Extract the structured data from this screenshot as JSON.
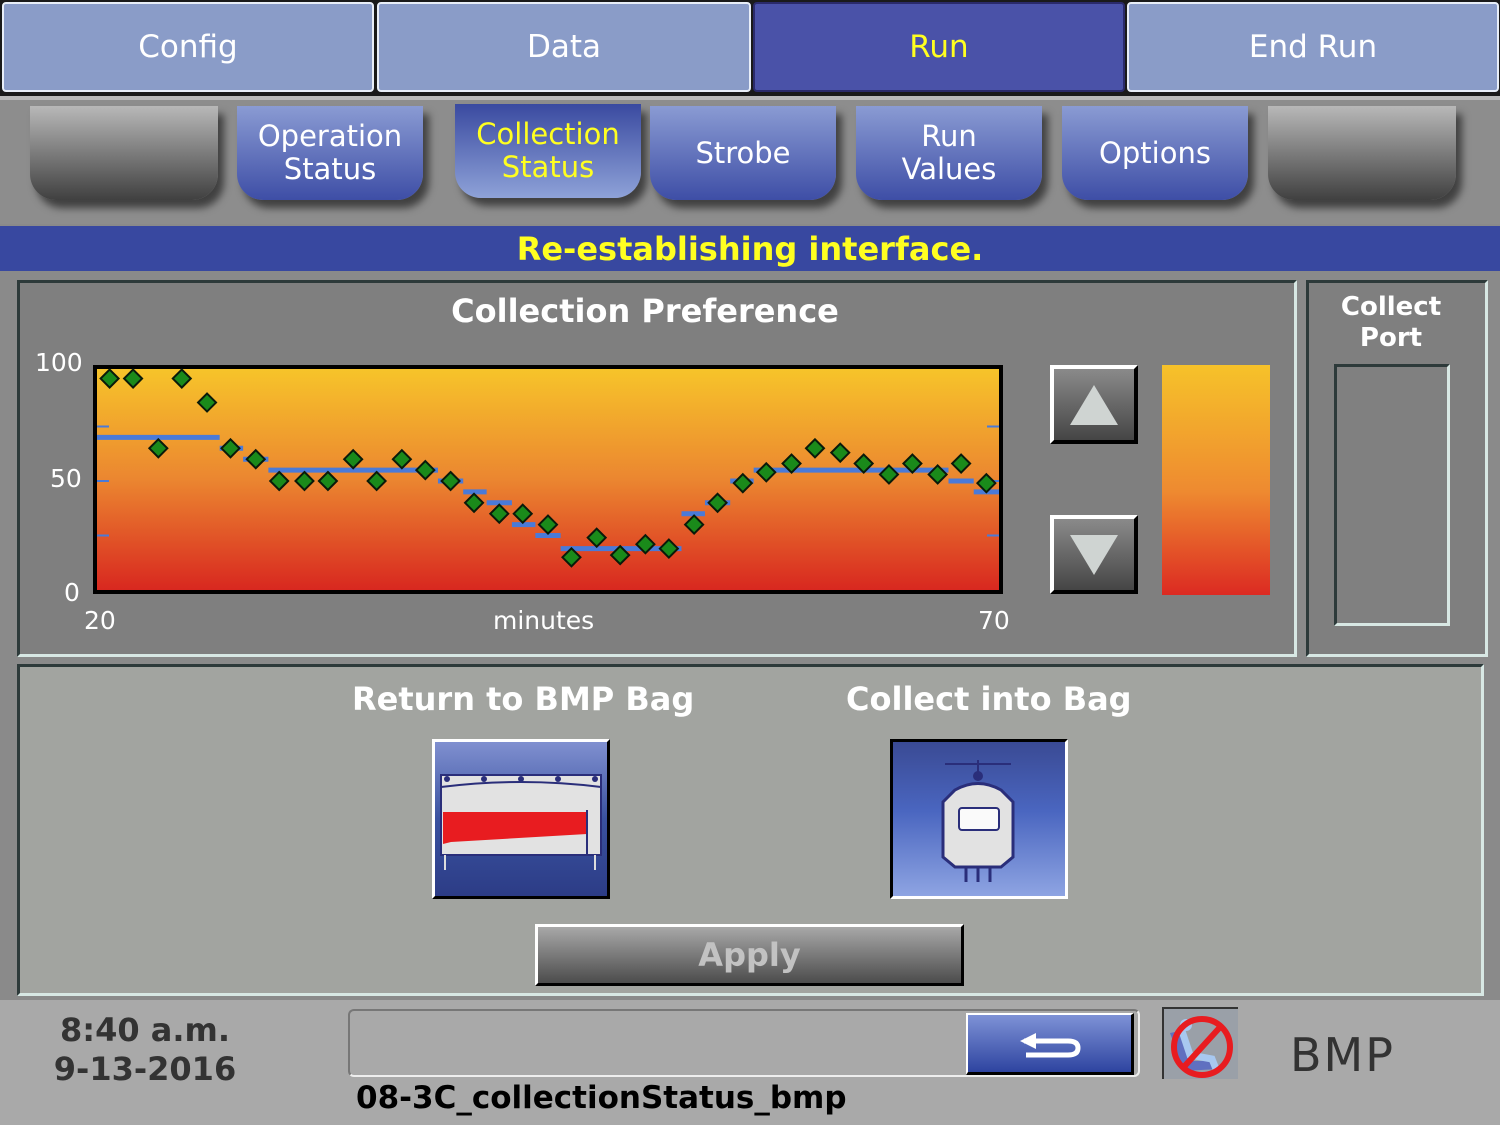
{
  "top_tabs": [
    {
      "label": "Config",
      "active": false
    },
    {
      "label": "Data",
      "active": false
    },
    {
      "label": "Run",
      "active": true
    },
    {
      "label": "End Run",
      "active": false
    }
  ],
  "sub_tabs": [
    {
      "label": "",
      "active": false,
      "blank": true
    },
    {
      "label": "Operation Status",
      "active": false
    },
    {
      "label": "Collection Status",
      "active": true
    },
    {
      "label": "Strobe",
      "active": false
    },
    {
      "label": "Run Values",
      "active": false
    },
    {
      "label": "Options",
      "active": false
    },
    {
      "label": "",
      "active": false,
      "blank": true
    }
  ],
  "status_banner": "Re-establishing interface.",
  "collection_preference": {
    "title": "Collection Preference",
    "increase_icon": "triangle-up-icon",
    "decrease_icon": "triangle-down-icon"
  },
  "chart_data": {
    "type": "scatter",
    "title": "Collection Preference",
    "xlabel": "minutes",
    "ylabel": "",
    "xlim": [
      20,
      70
    ],
    "ylim": [
      0,
      100
    ],
    "x_tick_labels": [
      "20",
      "70"
    ],
    "y_tick_labels": [
      "100",
      "50",
      "0"
    ],
    "minor_y_ticks": [
      25,
      50,
      75
    ],
    "grid": false,
    "series": [
      {
        "name": "measured",
        "marker": "diamond",
        "color": "#1a8a1a",
        "x": [
          20.7,
          22.0,
          23.4,
          24.7,
          26.1,
          27.4,
          28.8,
          30.1,
          31.5,
          32.8,
          34.2,
          35.5,
          36.9,
          38.2,
          39.6,
          40.9,
          42.3,
          43.6,
          45.0,
          46.3,
          47.7,
          49.0,
          50.4,
          51.7,
          53.1,
          54.4,
          55.8,
          57.1,
          58.5,
          59.8,
          61.2,
          62.5,
          63.9,
          65.2,
          66.6,
          67.9,
          69.3
        ],
        "y": [
          97,
          97,
          65,
          97,
          86,
          65,
          60,
          50,
          50,
          50,
          60,
          50,
          60,
          55,
          50,
          40,
          35,
          35,
          30,
          15,
          24,
          16,
          21,
          19,
          30,
          40,
          49,
          54,
          58,
          65,
          63,
          58,
          53,
          58,
          53,
          58,
          49
        ]
      },
      {
        "name": "preference",
        "style": "step",
        "color": "#4a7ad8",
        "segments": [
          {
            "x0": 20.0,
            "x1": 26.8,
            "y": 70
          },
          {
            "x0": 26.8,
            "x1": 28.1,
            "y": 65
          },
          {
            "x0": 28.1,
            "x1": 29.5,
            "y": 60
          },
          {
            "x0": 29.5,
            "x1": 38.9,
            "y": 55
          },
          {
            "x0": 38.9,
            "x1": 40.3,
            "y": 50
          },
          {
            "x0": 40.3,
            "x1": 41.6,
            "y": 45
          },
          {
            "x0": 41.6,
            "x1": 43.0,
            "y": 40
          },
          {
            "x0": 43.0,
            "x1": 44.3,
            "y": 30
          },
          {
            "x0": 44.3,
            "x1": 45.7,
            "y": 25
          },
          {
            "x0": 45.7,
            "x1": 52.4,
            "y": 19
          },
          {
            "x0": 52.4,
            "x1": 53.7,
            "y": 35
          },
          {
            "x0": 53.7,
            "x1": 55.1,
            "y": 40
          },
          {
            "x0": 55.1,
            "x1": 56.4,
            "y": 50
          },
          {
            "x0": 56.4,
            "x1": 67.2,
            "y": 55
          },
          {
            "x0": 67.2,
            "x1": 68.6,
            "y": 50
          },
          {
            "x0": 68.6,
            "x1": 70.0,
            "y": 45
          }
        ]
      }
    ]
  },
  "collect_port": {
    "title": "Collect Port",
    "value": ""
  },
  "destination": {
    "return_label": "Return to BMP Bag",
    "return_icon": "bmp-bag-icon",
    "collect_label": "Collect into Bag",
    "collect_icon": "collection-bag-icon",
    "selected": "Collect into Bag",
    "apply_label": "Apply",
    "apply_enabled": false
  },
  "footer": {
    "time": "8:40 a.m.",
    "date": "9-13-2016",
    "message": "",
    "back_icon": "return-arrow-icon",
    "status_icon": "no-recline-chair-icon",
    "mode": "BMP",
    "screen_id": "08-3C_collectionStatus_bmp"
  },
  "colors": {
    "tab_inactive": "#8a9cc8",
    "tab_active": "#4a52a8",
    "active_text": "#ffff20",
    "banner": "#3848a0",
    "marker": "#1a8a1a",
    "step_line": "#4a7ad8",
    "gradient_top": "#f6c22a",
    "gradient_bottom": "#dc2a22"
  }
}
